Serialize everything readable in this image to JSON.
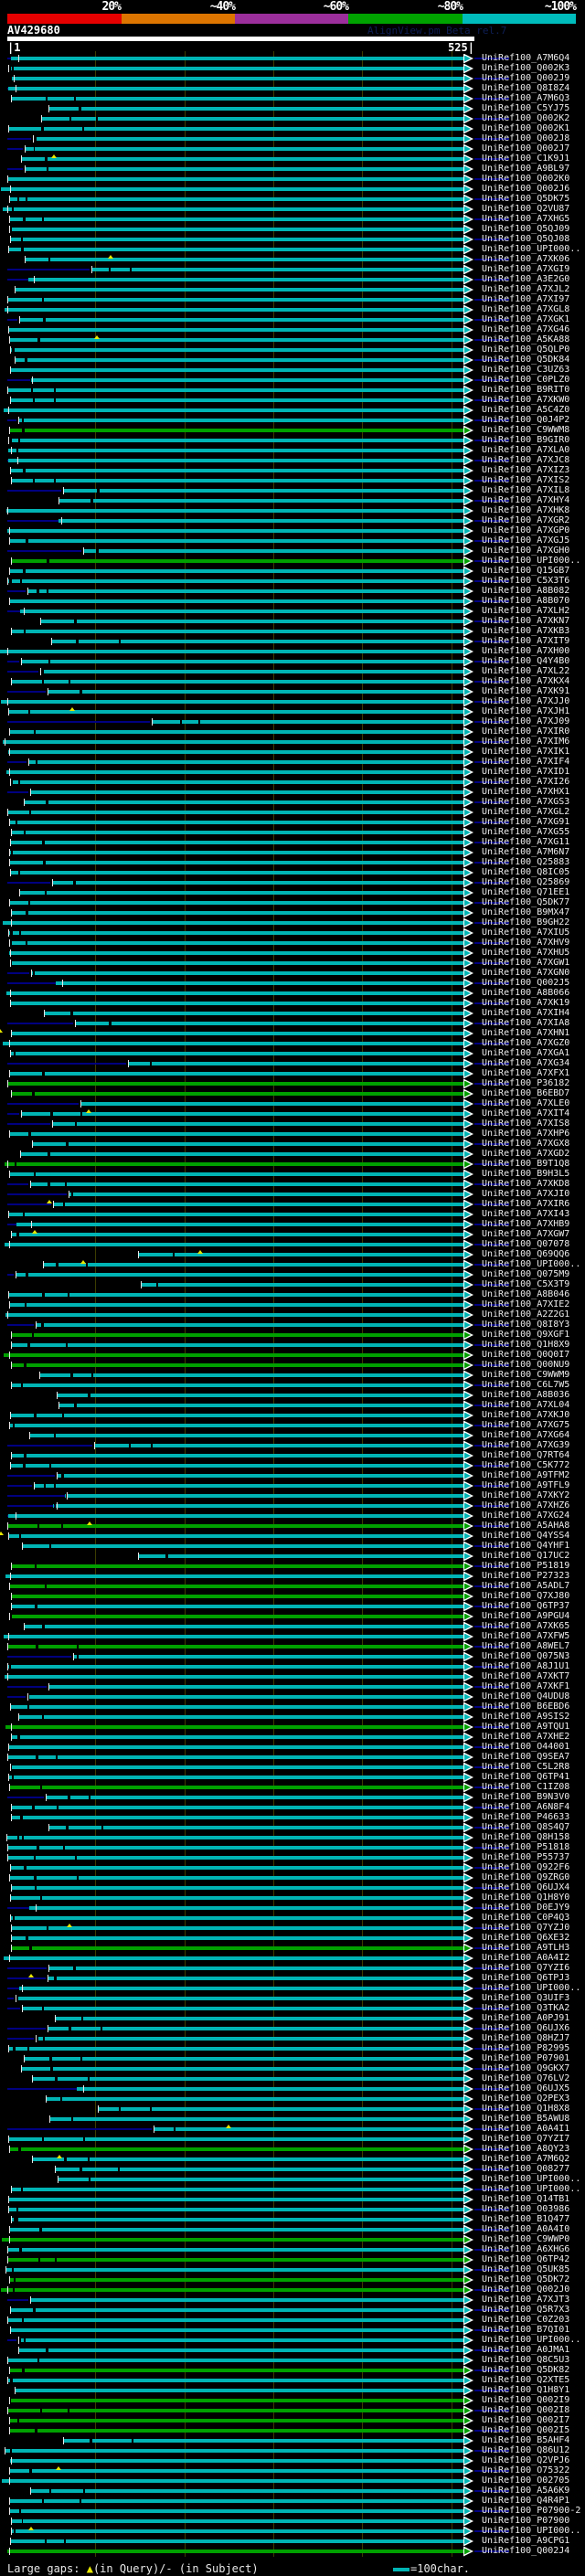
{
  "header": {
    "scale_labels": [
      "20%",
      "~40%",
      "~60%",
      "~80%",
      "~100%"
    ],
    "scale_colors": [
      "#e60000",
      "#dd7500",
      "#9c2f9c",
      "#00a300",
      "#00bcbc"
    ],
    "query_id": "AV429680",
    "app_credit": "AlignView.pm Beta rel.7",
    "ruler_start": "1",
    "ruler_end": "525"
  },
  "footer": {
    "legend_prefix": "Large gaps: ",
    "gap_query_symbol": "▲",
    "legend_mid": "(in Query)/",
    "gap_subject_symbol": "-",
    "legend_suffix": " (in Subject)",
    "scale_bar_label": "=100char."
  },
  "chart_data": {
    "type": "bar",
    "orientation": "horizontal",
    "title": "AV429680",
    "x_axis": {
      "min": 1,
      "max": 525,
      "tick_labels": [
        "1",
        "525"
      ],
      "gridline_interval": 100
    },
    "identity_color_key": [
      {
        "label": "20%",
        "color": "#e60000"
      },
      {
        "label": "~40%",
        "color": "#dd7500"
      },
      {
        "label": "~60%",
        "color": "#9c2f9c"
      },
      {
        "label": "~80%",
        "color": "#00a300"
      },
      {
        "label": "~100%",
        "color": "#00bcbc"
      }
    ],
    "bar_color_80_100": "#00b4b4",
    "bar_color_60_80": "#00a000",
    "subject_overhang_color": "#000080",
    "hit_ids": [
      "UniRef100_A7M6Q4",
      "UniRef100_Q002K3",
      "UniRef100_Q002J9",
      "UniRef100_Q8I8Z4",
      "UniRef100_A7M6Q3",
      "UniRef100_C5YJ75",
      "UniRef100_Q002K2",
      "UniRef100_Q002K1",
      "UniRef100_Q002J8",
      "UniRef100_Q002J7",
      "UniRef100_C1K9J1",
      "UniRef100_A9BL97",
      "UniRef100_Q002K0",
      "UniRef100_Q002J6",
      "UniRef100_Q5DK75",
      "UniRef100_Q2VU87",
      "UniRef100_A7XHG5",
      "UniRef100_Q5QJ09",
      "UniRef100_Q5QJ08",
      "UniRef100_UPI000..",
      "UniRef100_A7XK06",
      "UniRef100_A7XGI9",
      "UniRef100_A3E2G0",
      "UniRef100_A7XJL2",
      "UniRef100_A7XI97",
      "UniRef100_A7XGL8",
      "UniRef100_A7XGK1",
      "UniRef100_A7XG46",
      "UniRef100_A5KA88",
      "UniRef100_Q5QLP0",
      "UniRef100_Q5DK84",
      "UniRef100_C3UZ63",
      "UniRef100_C0PLZ0",
      "UniRef100_B9RIT0",
      "UniRef100_A7XKW0",
      "UniRef100_A5C4Z0",
      "UniRef100_Q0J4P2",
      "UniRef100_C9WWM8",
      "UniRef100_B9GIR0",
      "UniRef100_A7XLA0",
      "UniRef100_A7XJC8",
      "UniRef100_A7XIZ3",
      "UniRef100_A7XIS2",
      "UniRef100_A7XIL8",
      "UniRef100_A7XHY4",
      "UniRef100_A7XHK8",
      "UniRef100_A7XGR2",
      "UniRef100_A7XGP0",
      "UniRef100_A7XGJ5",
      "UniRef100_A7XGH0",
      "UniRef100_UPI000..",
      "UniRef100_Q15GB7",
      "UniRef100_C5X3T6",
      "UniRef100_A8B082",
      "UniRef100_A8B070",
      "UniRef100_A7XLH2",
      "UniRef100_A7XKN7",
      "UniRef100_A7XKB3",
      "UniRef100_A7XIT9",
      "UniRef100_A7XH00",
      "UniRef100_Q4Y4B0",
      "UniRef100_A7XL22",
      "UniRef100_A7XKX4",
      "UniRef100_A7XK91",
      "UniRef100_A7XJJ0",
      "UniRef100_A7XJH1",
      "UniRef100_A7XJ09",
      "UniRef100_A7XIR0",
      "UniRef100_A7XIM6",
      "UniRef100_A7XIK1",
      "UniRef100_A7XIF4",
      "UniRef100_A7XID1",
      "UniRef100_A7XI26",
      "UniRef100_A7XHX1",
      "UniRef100_A7XGS3",
      "UniRef100_A7XGL2",
      "UniRef100_A7XG91",
      "UniRef100_A7XG55",
      "UniRef100_A7XG11",
      "UniRef100_A7M6N7",
      "UniRef100_Q25883",
      "UniRef100_Q8IC05",
      "UniRef100_Q25869",
      "UniRef100_Q71EE1",
      "UniRef100_Q5DK77",
      "UniRef100_B9MX47",
      "UniRef100_B9GH22",
      "UniRef100_A7XIU5",
      "UniRef100_A7XHV9",
      "UniRef100_A7XHU5",
      "UniRef100_A7XGW1",
      "UniRef100_A7XGN0",
      "UniRef100_Q002J5",
      "UniRef100_A8B066",
      "UniRef100_A7XK19",
      "UniRef100_A7XIH4",
      "UniRef100_A7XIA8",
      "UniRef100_A7XHN1",
      "UniRef100_A7XGZ0",
      "UniRef100_A7XGA1",
      "UniRef100_A7XG34",
      "UniRef100_A7XFX1",
      "UniRef100_P36182",
      "UniRef100_B6EBD7",
      "UniRef100_A7XLE0",
      "UniRef100_A7XIT4",
      "UniRef100_A7XIS8",
      "UniRef100_A7XHP6",
      "UniRef100_A7XGX8",
      "UniRef100_A7XGD2",
      "UniRef100_B9T1Q8",
      "UniRef100_B9H3L5",
      "UniRef100_A7XKD8",
      "UniRef100_A7XJI0",
      "UniRef100_A7XIR6",
      "UniRef100_A7XI43",
      "UniRef100_A7XHB9",
      "UniRef100_A7XGW7",
      "UniRef100_Q07078",
      "UniRef100_Q69QQ6",
      "UniRef100_UPI000..",
      "UniRef100_Q075M9",
      "UniRef100_C5X3T9",
      "UniRef100_A8B046",
      "UniRef100_A7XIE2",
      "UniRef100_A2Z2G1",
      "UniRef100_Q8I8Y3",
      "UniRef100_Q9XGF1",
      "UniRef100_Q1H8X9",
      "UniRef100_Q0Q0I7",
      "UniRef100_Q00NU9",
      "UniRef100_C9WWM9",
      "UniRef100_C6L7W5",
      "UniRef100_A8B036",
      "UniRef100_A7XL04",
      "UniRef100_A7XKJ0",
      "UniRef100_A7XG75",
      "UniRef100_A7XG64",
      "UniRef100_A7XG39",
      "UniRef100_Q7RT64",
      "UniRef100_C5K772",
      "UniRef100_A9TFM2",
      "UniRef100_A9TFL9",
      "UniRef100_A7XKY2",
      "UniRef100_A7XHZ6",
      "UniRef100_A7XG24",
      "UniRef100_A5AHA8",
      "UniRef100_Q4YSS4",
      "UniRef100_Q4YHF1",
      "UniRef100_Q17UC2",
      "UniRef100_P51819",
      "UniRef100_P27323",
      "UniRef100_A5ADL7",
      "UniRef100_Q7XJ80",
      "UniRef100_Q6TP37",
      "UniRef100_A9PGU4",
      "UniRef100_A7XK65",
      "UniRef100_A7XFW5",
      "UniRef100_A8WEL7",
      "UniRef100_Q075N3",
      "UniRef100_A8J1U1",
      "UniRef100_A7XKT7",
      "UniRef100_A7XKF1",
      "UniRef100_Q4UDU8",
      "UniRef100_B6EBD6",
      "UniRef100_A9SIS2",
      "UniRef100_A9TQU1",
      "UniRef100_A7XHE2",
      "UniRef100_O44001",
      "UniRef100_Q9SEA7",
      "UniRef100_C5L2R8",
      "UniRef100_Q6TP41",
      "UniRef100_C1IZ08",
      "UniRef100_B9N3V0",
      "UniRef100_A6N8F4",
      "UniRef100_P46633",
      "UniRef100_Q8S4Q7",
      "UniRef100_Q8H158",
      "UniRef100_P51818",
      "UniRef100_P55737",
      "UniRef100_Q922F6",
      "UniRef100_Q9ZRG0",
      "UniRef100_Q6UJX4",
      "UniRef100_Q1H8Y0",
      "UniRef100_D0EJY9",
      "UniRef100_C0P4Q3",
      "UniRef100_Q7YZJ0",
      "UniRef100_Q6XE32",
      "UniRef100_A9TLH3",
      "UniRef100_A0A4I2",
      "UniRef100_Q7YZI6",
      "UniRef100_Q6TPJ3",
      "UniRef100_UPI000..",
      "UniRef100_Q3UIF3",
      "UniRef100_Q3TKA2",
      "UniRef100_A0PJ91",
      "UniRef100_Q6UJX6",
      "UniRef100_Q8HZJ7",
      "UniRef100_P82995",
      "UniRef100_P07901",
      "UniRef100_Q9GKX7",
      "UniRef100_Q76LV2",
      "UniRef100_Q6UJX5",
      "UniRef100_Q2PEX3",
      "UniRef100_Q1H8X8",
      "UniRef100_B5AWU8",
      "UniRef100_A0A4I1",
      "UniRef100_Q7YZI7",
      "UniRef100_A8QY23",
      "UniRef100_A7M6Q2",
      "UniRef100_Q08277",
      "UniRef100_UPI000..",
      "UniRef100_UPI000..",
      "UniRef100_Q14TB1",
      "UniRef100_O03986",
      "UniRef100_B1Q477",
      "UniRef100_A0A4I0",
      "UniRef100_C9WWP0",
      "UniRef100_A6XHG6",
      "UniRef100_Q6TP42",
      "UniRef100_Q5UK85",
      "UniRef100_Q5DK72",
      "UniRef100_Q002J0",
      "UniRef100_A7XJT3",
      "UniRef100_Q5R7X3",
      "UniRef100_C0Z203",
      "UniRef100_B7QI01",
      "UniRef100_UPI000..",
      "UniRef100_A0JMA1",
      "UniRef100_Q8C5U3",
      "UniRef100_Q5DK82",
      "UniRef100_Q2XTE5",
      "UniRef100_Q1H8Y1",
      "UniRef100_Q002I9",
      "UniRef100_Q002I8",
      "UniRef100_Q002I7",
      "UniRef100_Q002I5",
      "UniRef100_B5AHF4",
      "UniRef100_Q86U12",
      "UniRef100_Q2VPJ6",
      "UniRef100_O75322",
      "UniRef100_O02705",
      "UniRef100_A5A6K9",
      "UniRef100_Q4R4P1",
      "UniRef100_P07900-2",
      "UniRef100_P07900",
      "UniRef100_UPI000..",
      "UniRef100_A9CPG1",
      "UniRef100_Q002J4"
    ],
    "rows_60_80_identity": [
      38,
      51,
      103,
      104,
      111,
      128,
      130,
      131,
      147,
      151,
      153,
      154,
      156,
      159,
      167,
      173,
      189,
      209,
      218,
      220,
      222,
      223,
      231,
      234,
      235,
      236,
      237,
      249
    ]
  }
}
